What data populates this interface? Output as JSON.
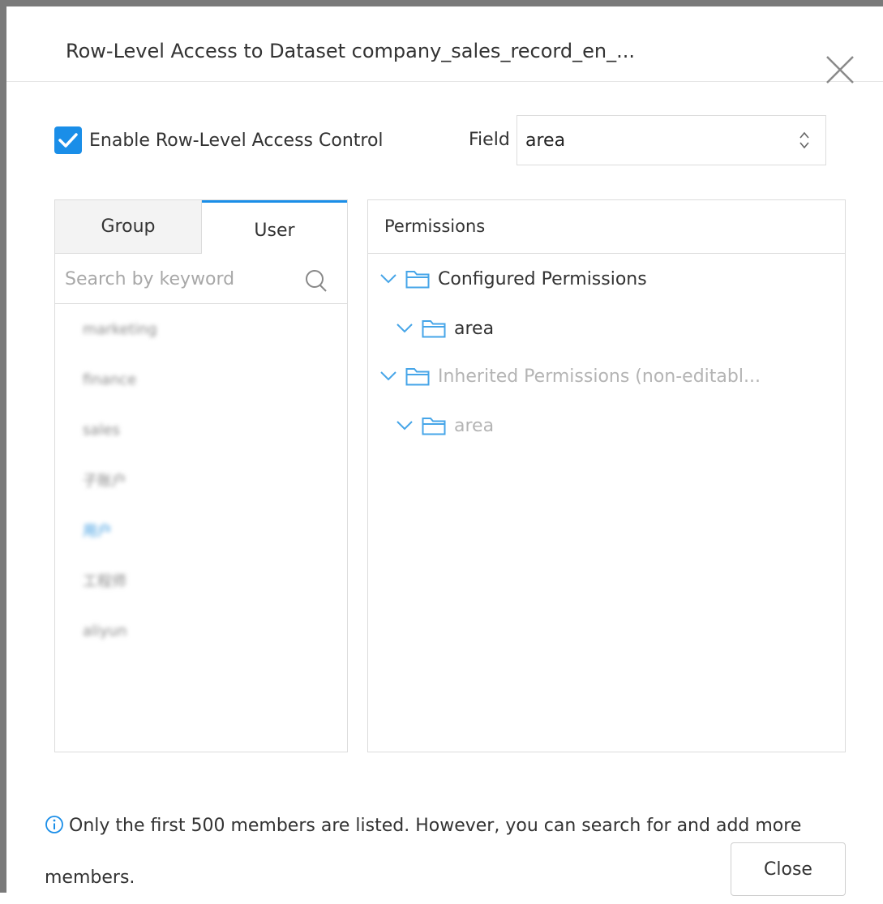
{
  "dialog": {
    "title": "Row-Level Access to Dataset company_sales_record_en_..."
  },
  "enable": {
    "label": "Enable Row-Level Access Control",
    "checked": true
  },
  "field": {
    "label": "Field",
    "value": "area"
  },
  "left_panel": {
    "tabs": [
      {
        "label": "Group",
        "active": false
      },
      {
        "label": "User",
        "active": true
      }
    ],
    "search": {
      "placeholder": "Search by keyword"
    },
    "items": [
      {
        "label": "marketing"
      },
      {
        "label": "finance"
      },
      {
        "label": "sales"
      },
      {
        "label": "子账户"
      },
      {
        "label": "用户",
        "selected": true
      },
      {
        "label": "工程师"
      },
      {
        "label": "aliyun"
      }
    ]
  },
  "permissions": {
    "title": "Permissions",
    "tree": [
      {
        "label": "Configured Permissions",
        "level": 0,
        "editable": true
      },
      {
        "label": "area",
        "level": 1,
        "editable": true
      },
      {
        "label": "Inherited Permissions (non-editabl...",
        "level": 0,
        "editable": false
      },
      {
        "label": "area",
        "level": 1,
        "editable": false
      }
    ]
  },
  "footer": {
    "note": "Only the first 500 members are listed. However, you can search for and add more members.",
    "close_label": "Close"
  },
  "colors": {
    "accent": "#1a8ee8",
    "border": "#dcdcdc",
    "muted_text": "#b4b4b4",
    "folder_icon": "#46a5e8"
  }
}
